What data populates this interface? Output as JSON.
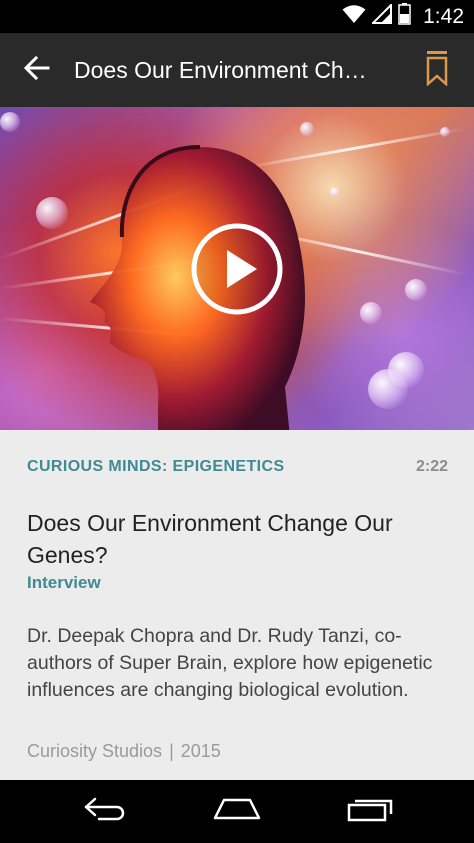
{
  "status_bar": {
    "time": "1:42",
    "icons": [
      "wifi-icon",
      "signal-icon",
      "battery-icon"
    ]
  },
  "app_bar": {
    "title": "Does Our Environment Ch…",
    "back_icon": "arrow-back-icon",
    "bookmark_icon": "bookmark-icon",
    "bookmark_color": "#d89a4a"
  },
  "hero": {
    "play_icon": "play-circle-icon"
  },
  "details": {
    "series": "CURIOUS MINDS: EPIGENETICS",
    "duration": "2:22",
    "title": "Does Our Environment Change Our Genes?",
    "type": "Interview",
    "description": "Dr. Deepak Chopra and Dr. Rudy Tanzi, co-authors of Super Brain, explore how epigenetic influences are changing biological evolution.",
    "studio": "Curiosity Studios",
    "separator": "|",
    "year": "2015"
  },
  "colors": {
    "accent": "#3f8a93",
    "app_bar_bg": "#2a2a2a",
    "content_bg": "#ececec"
  },
  "nav_bar": {
    "icons": [
      "back-nav-icon",
      "home-nav-icon",
      "recents-nav-icon"
    ]
  }
}
